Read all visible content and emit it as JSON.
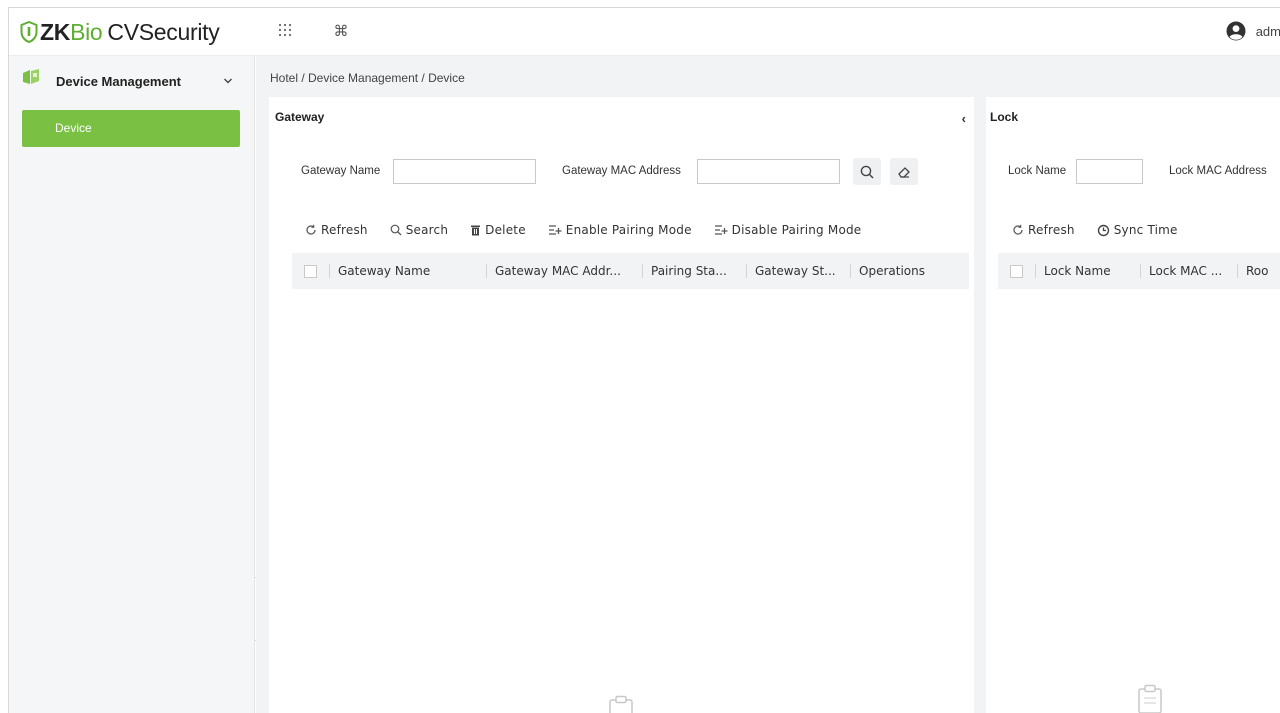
{
  "app": {
    "logo_zk": "ZK",
    "logo_bio": "Bio",
    "logo_rest": "CVSecurity",
    "user": "adm"
  },
  "sidebar": {
    "group_label": "Device Management",
    "items": [
      {
        "label": "Device",
        "active": true
      }
    ]
  },
  "breadcrumb": "Hotel / Device Management / Device",
  "gateway_panel": {
    "title": "Gateway",
    "filters": {
      "name_label": "Gateway Name",
      "name_value": "",
      "mac_label": "Gateway MAC Address",
      "mac_value": ""
    },
    "toolbar": [
      "Refresh",
      "Search",
      "Delete",
      "Enable Pairing Mode",
      "Disable Pairing Mode"
    ],
    "columns": [
      "Gateway Name",
      "Gateway MAC Addr...",
      "Pairing Sta...",
      "Gateway St...",
      "Operations"
    ]
  },
  "lock_panel": {
    "title": "Lock",
    "filters": {
      "name_label": "Lock Name",
      "name_value": "",
      "mac_label": "Lock MAC Address"
    },
    "toolbar": [
      "Refresh",
      "Sync Time"
    ],
    "columns": [
      "Lock Name",
      "Lock MAC ...",
      "Roo"
    ]
  },
  "colors": {
    "brand_green": "#7ac143",
    "logo_green": "#5fae32",
    "sidebar_bg": "#f5f6f7",
    "main_bg": "#f2f3f4"
  },
  "icons": {
    "app_grid": "grid-icon",
    "shortcut": "command-icon",
    "user": "user-icon"
  }
}
